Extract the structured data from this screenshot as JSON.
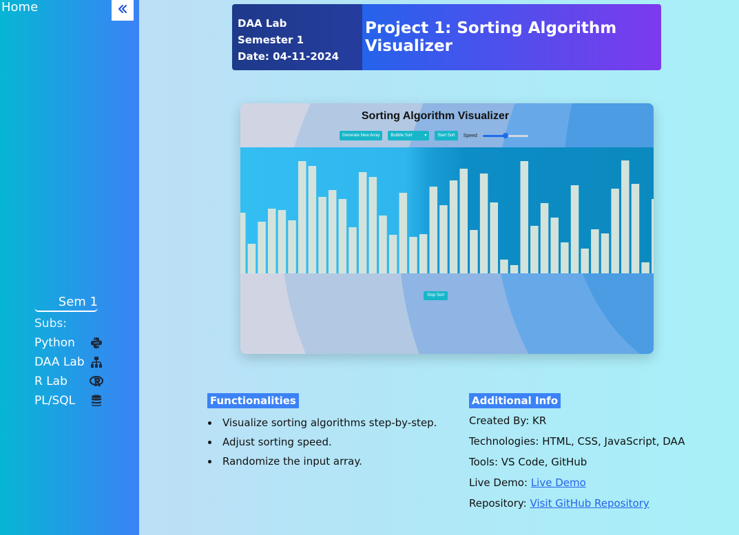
{
  "sidebar": {
    "home_label": "Home",
    "collapse_icon": "double-chevron-left-icon",
    "sem_title": "Sem 1",
    "subs_label": "Subs:",
    "items": [
      {
        "label": "Python",
        "icon": "python-icon"
      },
      {
        "label": "DAA Lab",
        "icon": "sitemap-icon"
      },
      {
        "label": "R Lab",
        "icon": "r-logo-icon"
      },
      {
        "label": "PL/SQL",
        "icon": "database-icon"
      }
    ]
  },
  "header": {
    "lab": "DAA Lab",
    "semester": "Semester 1",
    "date": "Date: 04-11-2024",
    "project_title": "Project 1: Sorting Algorithm Visualizer"
  },
  "preview": {
    "title": "Sorting Algorithm Visualizer",
    "generate_label": "Generate New Array",
    "algorithm_selected": "Bubble Sort",
    "start_label": "Start Sort",
    "speed_label": "Speed",
    "speed_level": 0.5,
    "stop_label": "Stop Sort",
    "bar_values": [
      88,
      43,
      75,
      94,
      92,
      77,
      163,
      156,
      111,
      121,
      108,
      67,
      147,
      140,
      84,
      56,
      117,
      53,
      57,
      126,
      99,
      135,
      152,
      63,
      145,
      103,
      20,
      12,
      163,
      69,
      102,
      81,
      45,
      128,
      36,
      64,
      58,
      123,
      164,
      130,
      16,
      108
    ],
    "colors": {
      "bars": "#d3e3dc",
      "buttons": "#17b6c9"
    }
  },
  "functionalities": {
    "title": "Functionalities",
    "items": [
      "Visualize sorting algorithms step-by-step.",
      "Adjust sorting speed.",
      "Randomize the input array."
    ]
  },
  "additional_info": {
    "title": "Additional Info",
    "created_by_label": "Created By:",
    "created_by_value": "KR",
    "technologies_label": "Technologies:",
    "technologies_value": "HTML, CSS, JavaScript, DAA",
    "tools_label": "Tools:",
    "tools_value": "VS Code, GitHub",
    "live_demo_label": "Live Demo:",
    "live_demo_link": "Live Demo",
    "repository_label": "Repository:",
    "repository_link": "Visit GitHub Repository"
  }
}
